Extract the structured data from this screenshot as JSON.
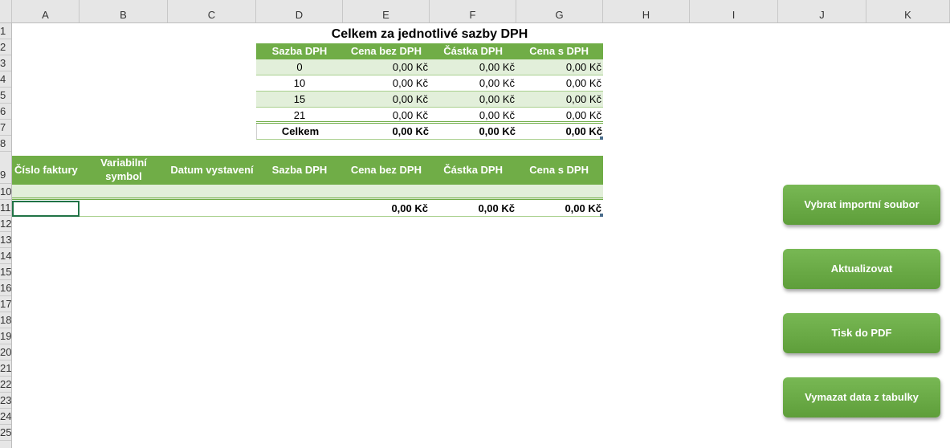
{
  "columns": [
    "A",
    "B",
    "C",
    "D",
    "E",
    "F",
    "G",
    "H",
    "I",
    "J",
    "K"
  ],
  "rows": [
    "1",
    "2",
    "3",
    "4",
    "5",
    "6",
    "7",
    "8",
    "9",
    "10",
    "11",
    "12",
    "13",
    "14",
    "15",
    "16",
    "17",
    "18",
    "19",
    "20",
    "21",
    "22",
    "23",
    "24",
    "25"
  ],
  "summary": {
    "title": "Celkem za jednotlivé sazby DPH",
    "headers": [
      "Sazba DPH",
      "Cena bez DPH",
      "Částka DPH",
      "Cena s DPH"
    ],
    "rows": [
      [
        "0",
        "0,00 Kč",
        "0,00 Kč",
        "0,00 Kč"
      ],
      [
        "10",
        "0,00 Kč",
        "0,00 Kč",
        "0,00 Kč"
      ],
      [
        "15",
        "0,00 Kč",
        "0,00 Kč",
        "0,00 Kč"
      ],
      [
        "21",
        "0,00 Kč",
        "0,00 Kč",
        "0,00 Kč"
      ]
    ],
    "total": [
      "Celkem",
      "0,00 Kč",
      "0,00 Kč",
      "0,00 Kč"
    ]
  },
  "invoices": {
    "headers": [
      "Číslo faktury",
      "Variabilní symbol",
      "Datum vystavení",
      "Sazba DPH",
      "Cena bez DPH",
      "Částka DPH",
      "Cena s DPH"
    ],
    "total": [
      "0,00 Kč",
      "0,00 Kč",
      "0,00 Kč"
    ]
  },
  "buttons": {
    "import": "Vybrat importní soubor",
    "update": "Aktualizovat",
    "pdf": "Tisk do PDF",
    "clear": "Vymazat data z tabulky"
  }
}
